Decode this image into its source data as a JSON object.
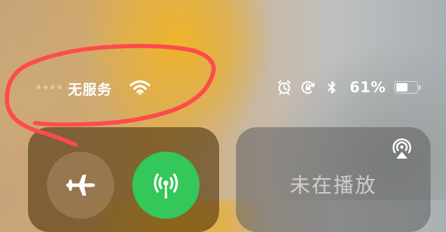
{
  "status_bar": {
    "carrier": "无服务",
    "signal_icon": "cellular-signal-empty",
    "wifi_icon": "wifi-icon",
    "right_icons": [
      "alarm-icon",
      "rotation-lock-icon",
      "bluetooth-icon"
    ],
    "battery_percent_text": "61%",
    "battery_level": 0.61
  },
  "connectivity": {
    "airplane_icon": "airplane-icon",
    "cellular_icon": "cellular-data-icon",
    "cellular_color": "#34c759"
  },
  "media": {
    "status_label": "未在播放",
    "airplay_icon": "airplay-audio-icon"
  },
  "annotation": {
    "color": "#ff4b4b"
  }
}
